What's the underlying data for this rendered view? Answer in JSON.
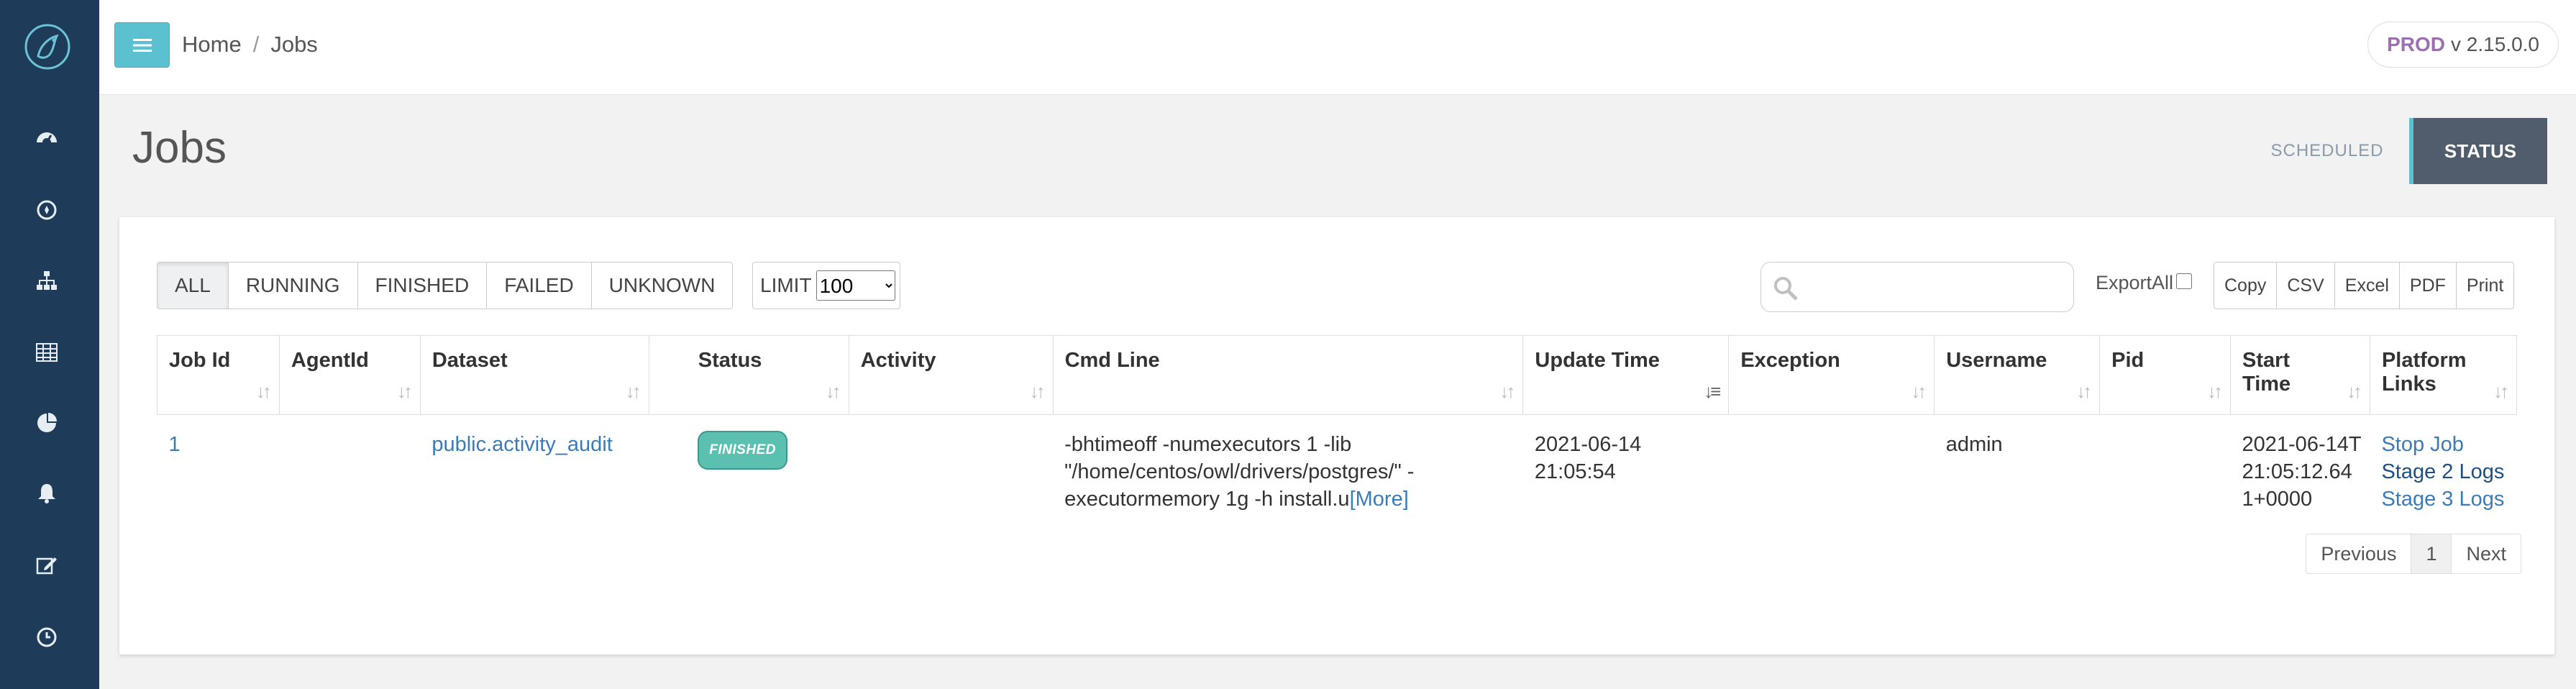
{
  "breadcrumb": {
    "home": "Home",
    "separator": "/",
    "current": "Jobs"
  },
  "env": {
    "name": "PROD",
    "version": "v 2.15.0.0"
  },
  "page": {
    "title": "Jobs"
  },
  "view_tabs": {
    "scheduled": "SCHEDULED",
    "status": "STATUS"
  },
  "filters": [
    "ALL",
    "RUNNING",
    "FINISHED",
    "FAILED",
    "UNKNOWN"
  ],
  "limit": {
    "label": "LIMIT",
    "value": "100"
  },
  "search": {
    "placeholder": ""
  },
  "export": {
    "export_all_label": "ExportAll",
    "buttons": [
      "Copy",
      "CSV",
      "Excel",
      "PDF",
      "Print"
    ]
  },
  "table": {
    "columns": [
      "Job Id",
      "AgentId",
      "Dataset",
      "Status",
      "Activity",
      "Cmd Line",
      "Update Time",
      "Exception",
      "Username",
      "Pid",
      "Start Time",
      "Platform Links"
    ],
    "rows": [
      {
        "job_id": "1",
        "agent_id": "",
        "dataset": "public.activity_audit",
        "status": "FINISHED",
        "activity": "",
        "cmd_line": "-bhtimeoff -numexecutors 1 -lib \"/home/centos/owl/drivers/postgres/\" -executormemory 1g -h install.u",
        "cmd_more": "[More]",
        "update_time": "2021-06-14 21:05:54",
        "exception": "",
        "username": "admin",
        "pid": "",
        "start_time": "2021-06-14T21:05:12.641+0000",
        "links": [
          "Stop Job",
          "Stage 2 Logs",
          "Stage 3 Logs"
        ]
      }
    ]
  },
  "pagination": {
    "previous": "Previous",
    "page": "1",
    "next": "Next"
  },
  "colors": {
    "sidebar": "#1e3b5a",
    "accent": "#5bc0d0",
    "status_tab": "#515c6c",
    "badge": "#5bc0b0",
    "link": "#3a7bb8"
  }
}
